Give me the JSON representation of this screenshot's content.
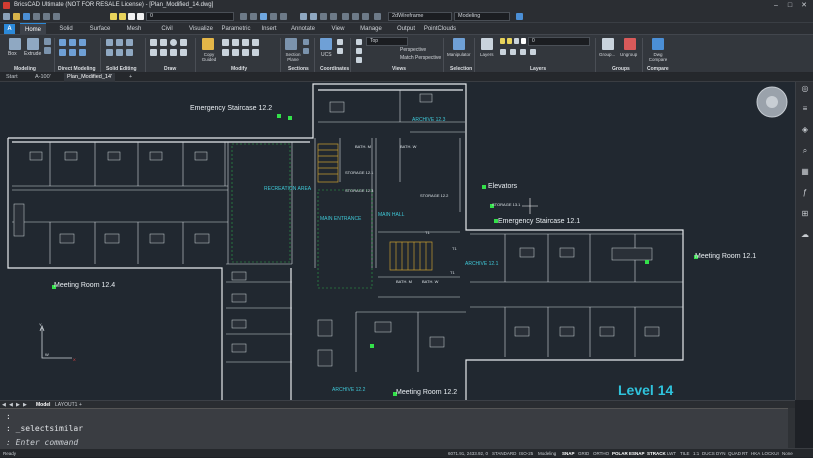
{
  "window": {
    "title": "BricsCAD Ultimate (NOT FOR RESALE License) - [Plan_Modified_14.dwg]"
  },
  "quick_access": {
    "layer_value": "0",
    "visual_style": "2dWireframe",
    "workspace": "Modeling"
  },
  "ribbon_tabs": [
    "Home",
    "Solid",
    "Surface",
    "Mesh",
    "Civil",
    "Visualize",
    "Parametric",
    "Insert",
    "Annotate",
    "View",
    "Manage",
    "Output",
    "PointClouds"
  ],
  "ribbon_active_tab": "Home",
  "ribbon_panels": [
    "Modeling",
    "Direct Modeling",
    "Solid Editing",
    "Draw",
    "Modify",
    "Sections",
    "Coordinates",
    "Views",
    "Selection",
    "Layers",
    "Groups",
    "Compare"
  ],
  "ribbon_buttons": {
    "box": "Box",
    "extrude": "Extrude",
    "copy_guided": "Copy Guided",
    "section_plane": "Section Plane",
    "ucs": "UCS",
    "view_top": "Top",
    "perspective": "Perspective",
    "match_perspective": "Match Perspective",
    "manipulator": "Manipulator",
    "layers": "Layers",
    "group": "Group...",
    "ungroup": "Ungroup",
    "dwg_compare": "Dwg Compare",
    "layer_dropdown": "0"
  },
  "doc_tabs": [
    "Start",
    "A-100'",
    "Plan_Modified_14'"
  ],
  "drawing": {
    "rooms": [
      "Emergency Staircase 12.2",
      "Elevators",
      "Emergency Staircase 12.1",
      "Meeting Room 12.1",
      "Meeting Room 12.4",
      "Meeting Room 12.2"
    ],
    "archives": [
      "ARCHIVE 12.3",
      "ARCHIVE 12.1",
      "ARCHIVE 12.2"
    ],
    "areas": {
      "recreation": "RECREATION AREA",
      "main_entrance": "MAIN ENTRANCE",
      "main_hall": "MAIN HALL",
      "storage_13_1": "STORAGE 13.1",
      "storage_12_1": "STORAGE 12.1",
      "storage_12_2": "STORAGE 12.2",
      "storage_12_3": "STORAGE 12.3",
      "t1": "T1",
      "t1b": "T1",
      "t1c": "T1",
      "bath_m": "BATH. M",
      "bath_w": "BATH. W",
      "bath_m2": "BATH. M",
      "bath_w2": "BATH. W"
    },
    "level": "Level 14",
    "ucs": {
      "y": "Y",
      "w": "W",
      "x": "X"
    }
  },
  "layout_tabs": {
    "model": "Model",
    "layout": "LAYOUT1"
  },
  "command": {
    "history1": ":",
    "history2": ": _selectsimilar",
    "prompt": ": Enter command"
  },
  "status": {
    "left": "Ready",
    "coords": "6071.91, 2433.92, 0",
    "items": [
      "STANDARD",
      "ISO-25",
      "Modeling",
      "SNAP",
      "GRID",
      "ORTHO",
      "POLAR",
      "ESNAP",
      "STRACK",
      "LWT",
      "TILE",
      "1:1",
      "DUCS",
      "DYN",
      "QUAD",
      "RT",
      "HKA",
      "LOCKUI",
      "None"
    ]
  },
  "colors": {
    "accent": "#2c89d8",
    "canvas": "#212830",
    "level_text": "#2fc3dc",
    "marker": "#33e14a"
  }
}
